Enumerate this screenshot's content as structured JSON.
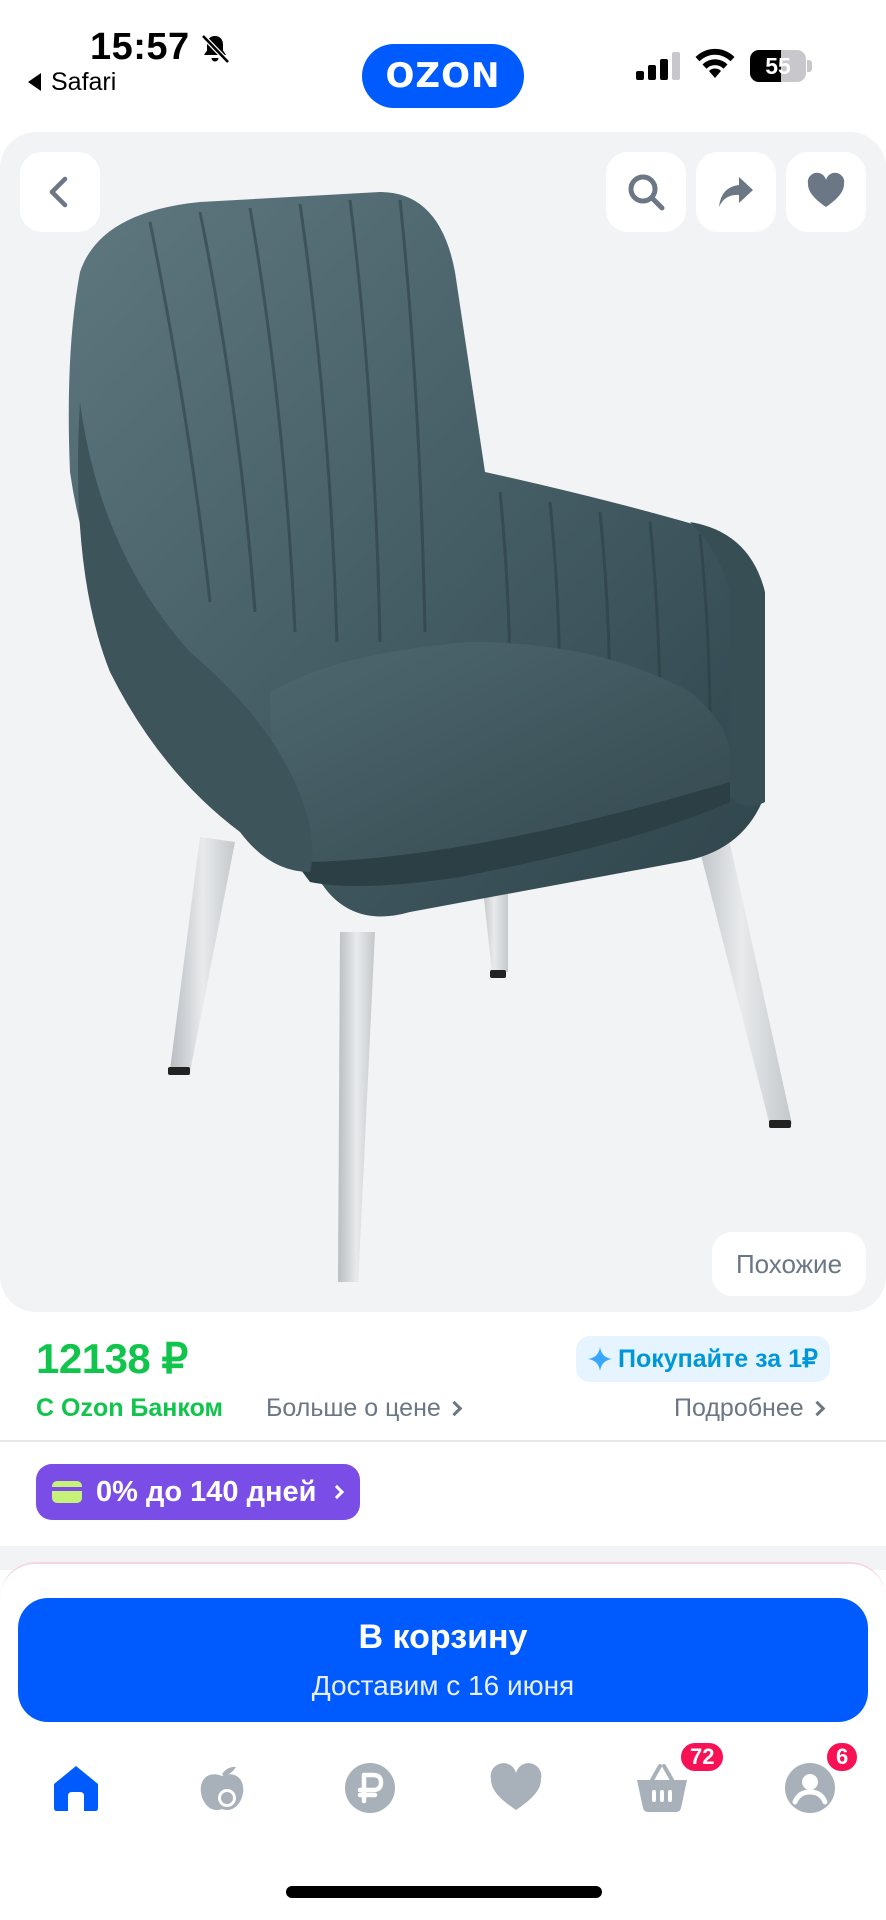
{
  "status_bar": {
    "time": "15:57",
    "back_app": "Safari",
    "battery": "55",
    "battery_level": 0.55
  },
  "header": {
    "logo": "OZON"
  },
  "gallery": {
    "back_icon": "chevron-left-icon",
    "actions": [
      "search-icon",
      "share-icon",
      "heart-icon"
    ],
    "similar_label": "Похожие"
  },
  "price": {
    "value": "12138 ₽",
    "bank_label": "С Ozon Банком",
    "more_label": "Больше о цене",
    "buy_for_label": "Покупайте за 1₽",
    "details_label": "Подробнее",
    "installment_label": "0% до 140 дней"
  },
  "cart": {
    "title": "В корзину",
    "subtitle": "Доставим с 16 июня"
  },
  "tabbar": {
    "items": [
      "home-icon",
      "fresh-icon",
      "ruble-icon",
      "favorites-icon",
      "cart-icon",
      "profile-icon"
    ],
    "cart_badge": "72",
    "profile_badge": "6"
  },
  "colors": {
    "brand": "#005bff",
    "price_green": "#10c44c",
    "installment": "#7a4de6",
    "badge": "#f91155"
  }
}
